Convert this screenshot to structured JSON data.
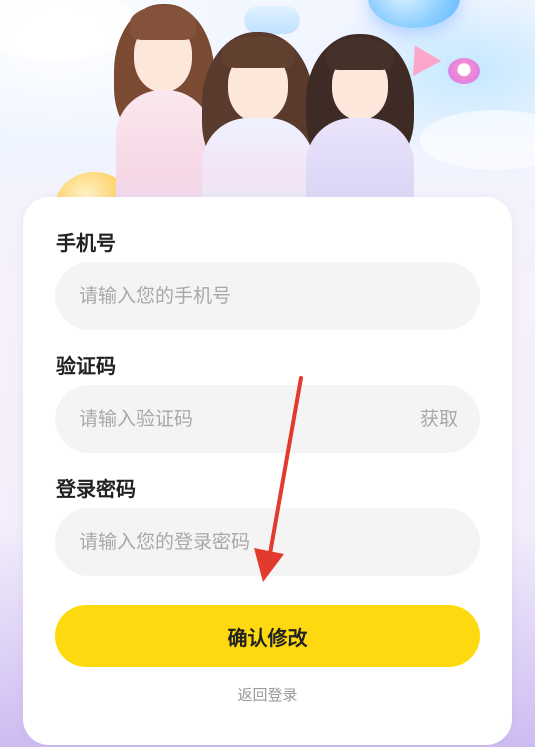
{
  "form": {
    "phone": {
      "label": "手机号",
      "placeholder": "请输入您的手机号",
      "value": ""
    },
    "code": {
      "label": "验证码",
      "placeholder": "请输入验证码",
      "value": "",
      "get_code_label": "获取"
    },
    "password": {
      "label": "登录密码",
      "placeholder": "请输入您的登录密码",
      "value": ""
    },
    "confirm_label": "确认修改",
    "back_label": "返回登录"
  },
  "colors": {
    "primary_button": "#ffd90f",
    "field_background": "#f4f4f5",
    "annotation_arrow": "#e23b2e"
  },
  "icons": {
    "hero": "banner-illustration",
    "annotation": "red-arrow-annotation"
  }
}
